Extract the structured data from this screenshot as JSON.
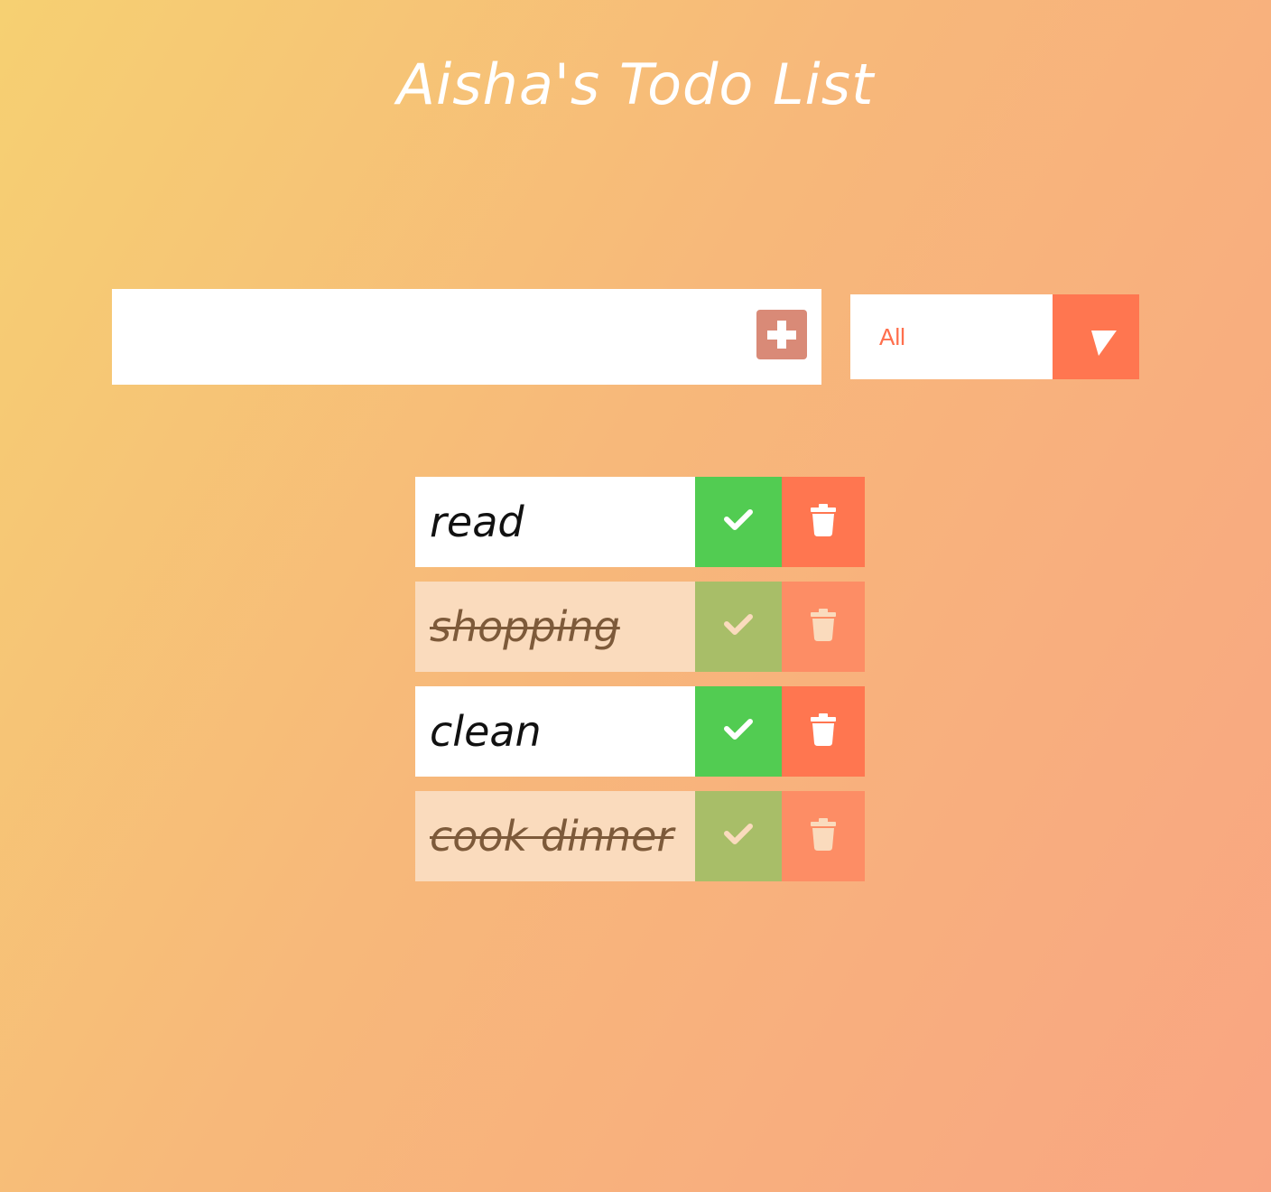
{
  "header": {
    "title": "Aisha's Todo List"
  },
  "add_form": {
    "input_value": "",
    "input_placeholder": "",
    "add_icon": "plus-icon"
  },
  "filter": {
    "selected": "All",
    "arrow_icon": "chevron-down-icon"
  },
  "todos": [
    {
      "text": "read",
      "completed": false
    },
    {
      "text": "shopping",
      "completed": true
    },
    {
      "text": "clean",
      "completed": false
    },
    {
      "text": "cook dinner",
      "completed": true
    }
  ],
  "icons": {
    "check": "check-icon",
    "delete": "trash-icon"
  },
  "colors": {
    "background_start": "#f6d072",
    "background_end": "#f9a582",
    "accent": "#ff7650",
    "add_button": "#d98a77",
    "check_green": "#52cc52",
    "completed_item": "#fadbbd",
    "completed_check": "#a8be68",
    "completed_trash": "#fd8d65"
  }
}
